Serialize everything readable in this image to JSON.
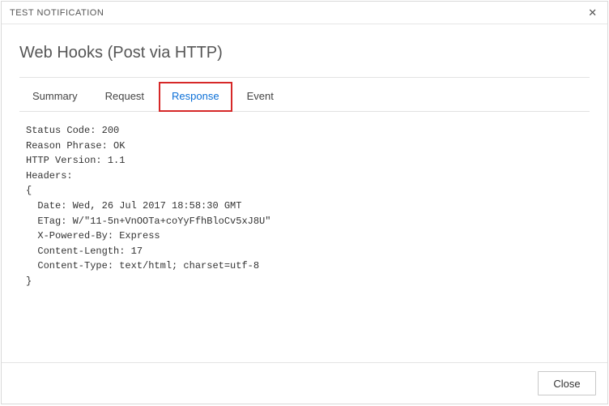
{
  "titlebar": {
    "title": "TEST NOTIFICATION",
    "close_glyph": "✕"
  },
  "header": {
    "subject": "Web Hooks (Post via HTTP)"
  },
  "tabs": [
    {
      "label": "Summary",
      "active": false
    },
    {
      "label": "Request",
      "active": false
    },
    {
      "label": "Response",
      "active": true
    },
    {
      "label": "Event",
      "active": false
    }
  ],
  "response_text": "Status Code: 200\nReason Phrase: OK\nHTTP Version: 1.1\nHeaders:\n{\n  Date: Wed, 26 Jul 2017 18:58:30 GMT\n  ETag: W/\"11-5n+VnOOTa+coYyFfhBloCv5xJ8U\"\n  X-Powered-By: Express\n  Content-Length: 17\n  Content-Type: text/html; charset=utf-8\n}",
  "footer": {
    "close_label": "Close"
  }
}
